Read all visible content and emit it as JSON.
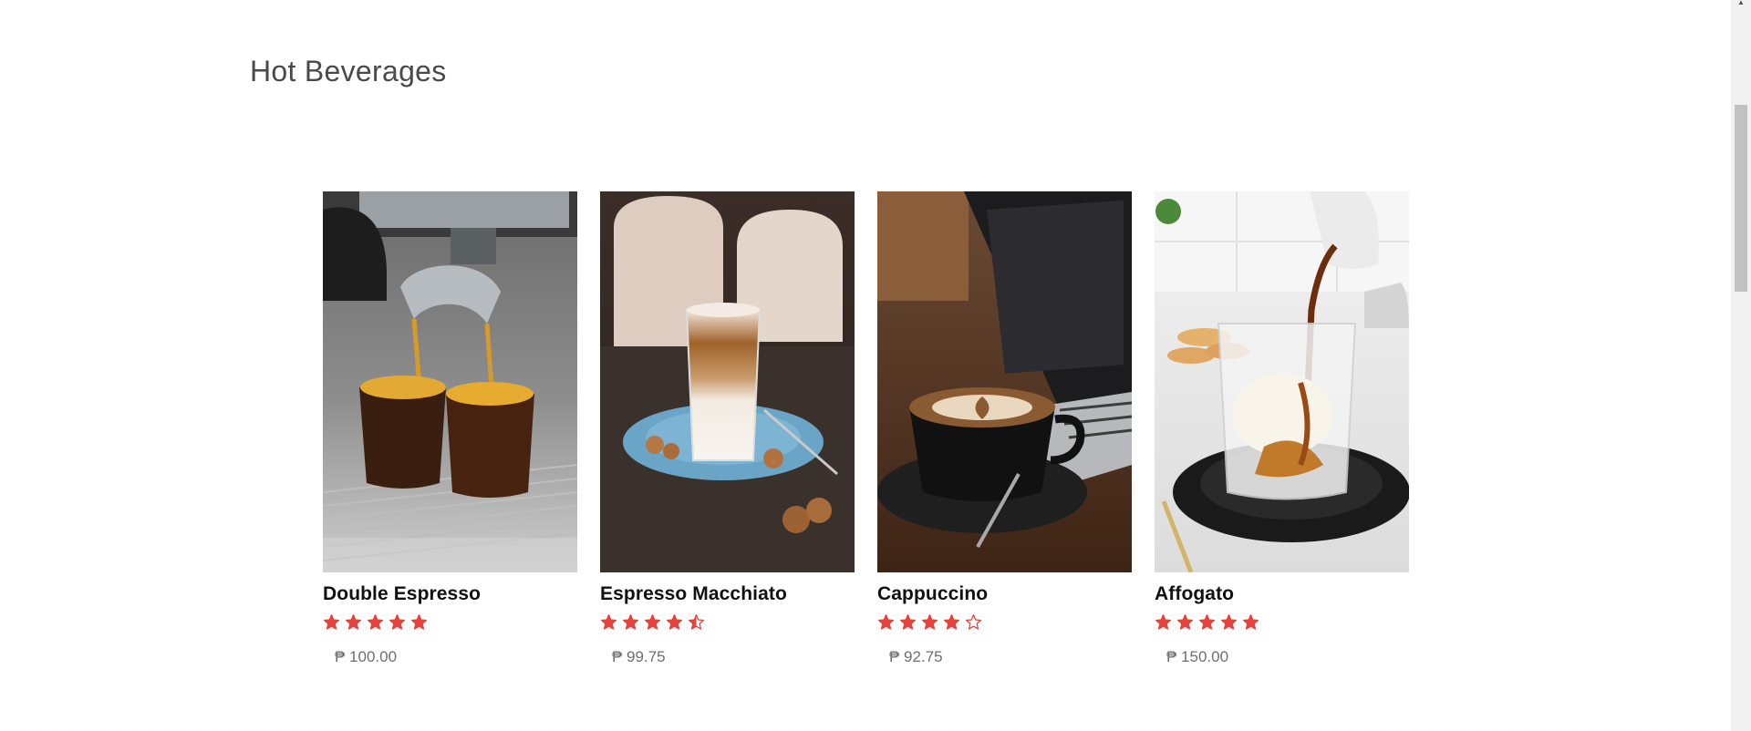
{
  "section": {
    "title": "Hot Beverages"
  },
  "products": [
    {
      "name": "Double Espresso",
      "rating": 5,
      "rating_max": 5,
      "price": "₱ 100.00",
      "image": "double-espresso-photo"
    },
    {
      "name": "Espresso Macchiato",
      "rating": 4.5,
      "rating_max": 5,
      "price": "₱ 99.75",
      "image": "espresso-macchiato-photo"
    },
    {
      "name": "Cappuccino",
      "rating": 4,
      "rating_max": 5,
      "price": "₱ 92.75",
      "image": "cappuccino-photo"
    },
    {
      "name": "Affogato",
      "rating": 5,
      "rating_max": 5,
      "price": "₱ 150.00",
      "image": "affogato-photo"
    }
  ],
  "colors": {
    "star": "#e8413a",
    "title": "#4a4a4a",
    "price": "#6f6f6f",
    "name": "#111111"
  }
}
